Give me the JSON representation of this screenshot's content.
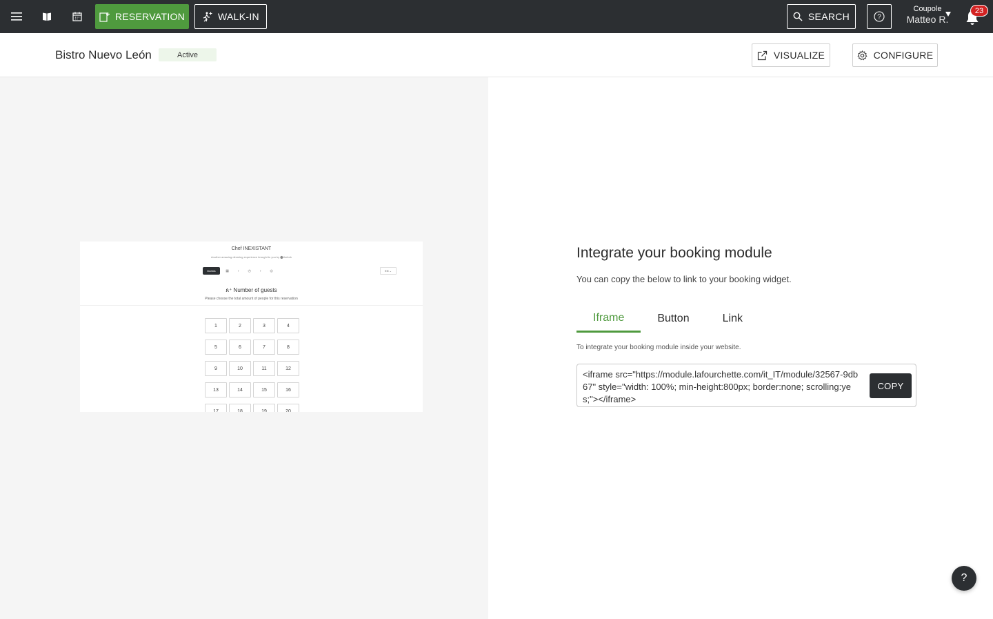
{
  "topbar": {
    "menu_icon": "hamburger-icon",
    "book_icon": "book-icon",
    "calendar_icon": "calendar-icon",
    "reservation_label": "RESERVATION",
    "walkin_label": "WALK-IN",
    "search_label": "SEARCH",
    "help_icon": "question-circle-icon",
    "user": {
      "restaurant": "Coupole",
      "name": "Matteo R."
    },
    "notifications_count": "23",
    "accent_color": "#4f9a3e",
    "bar_color": "#2c2f32"
  },
  "subheader": {
    "venue_name": "Bistro Nuevo León",
    "status": "Active",
    "visualize_label": "VISUALIZE",
    "configure_label": "CONFIGURE"
  },
  "preview": {
    "title": "Chef INEXISTANT",
    "subtitle": "Another amazing dimming experience brought to you by ⬤thefork",
    "active_step": "Guests",
    "lang": "EN",
    "heading": "Number of guests",
    "description": "Please choose the total amount of people for this reservation",
    "guest_options": [
      "1",
      "2",
      "3",
      "4",
      "5",
      "6",
      "7",
      "8",
      "9",
      "10",
      "11",
      "12",
      "13",
      "14",
      "15",
      "16",
      "17",
      "18",
      "19",
      "20"
    ]
  },
  "integration": {
    "title": "Integrate your booking module",
    "subtitle": "You can copy the below to link to your booking widget.",
    "tabs": [
      {
        "label": "Iframe"
      },
      {
        "label": "Button"
      },
      {
        "label": "Link"
      }
    ],
    "active_tab": "Iframe",
    "help_text": "To integrate your booking module inside your website.",
    "code": "<iframe src=\"https://module.lafourchette.com/it_IT/module/32567-9db67\" style=\"width: 100%; min-height:800px; border:none; scrolling:yes;\"></iframe>",
    "copy_label": "COPY"
  },
  "fab_label": "?"
}
